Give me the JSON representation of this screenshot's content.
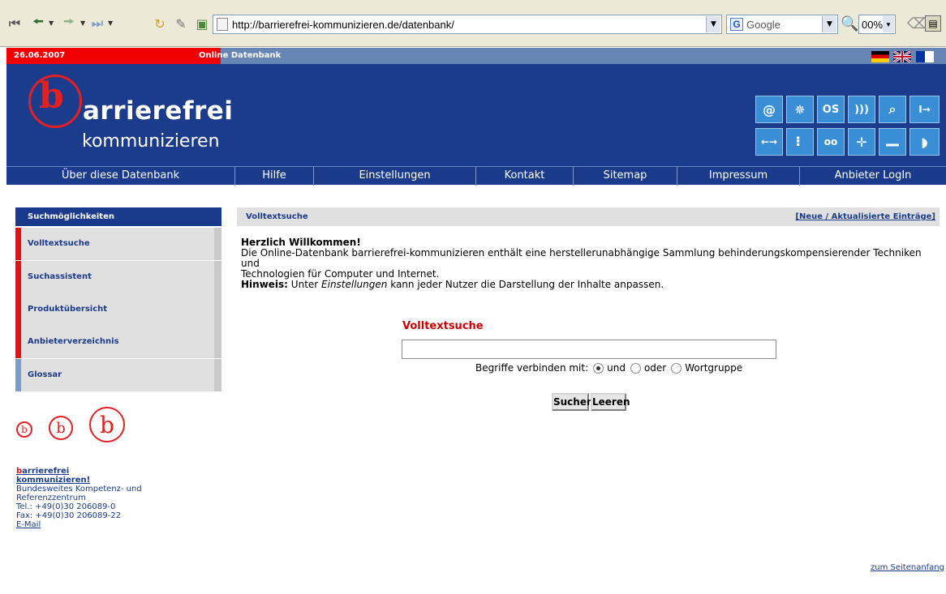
{
  "browser": {
    "url": "http://barrierefrei-kommunizieren.de/datenbank/",
    "search_engine_label": "Google",
    "zoom": "00%"
  },
  "header": {
    "date": "26.06.2007",
    "section": "Online Datenbank",
    "logo_line1": "arrierefrei",
    "logo_line2": "kommunizieren",
    "logo_letter": "b",
    "flags": [
      "de",
      "uk",
      "fr"
    ],
    "icons_top": [
      "@",
      "✵",
      "OS",
      ")))",
      "⌕",
      "I→"
    ],
    "icons_bottom": [
      "←→",
      "⠇",
      "oo",
      "✛",
      "▂▂",
      "◗"
    ]
  },
  "nav": {
    "items": [
      "Über diese Datenbank",
      "Hilfe",
      "Einstellungen",
      "Kontakt",
      "Sitemap",
      "Impressum",
      "Anbieter LogIn"
    ]
  },
  "sidebar": {
    "title": "Suchmöglichkeiten",
    "items": [
      "Volltextsuche",
      "Suchassistent",
      "Produktübersicht",
      "Anbieterverzeichnis",
      "Glossar"
    ],
    "org_name_red": "b",
    "org_name_rest": "arrierefrei",
    "org_name_line2": "kommunizieren!",
    "contact_line1": "Bundesweites Kompetenz- und",
    "contact_line2": "Referenzzentrum",
    "phone": "Tel.: +49(0)30 206089-0",
    "fax": "Fax: +49(0)30 206089-22",
    "email": "E-Mail"
  },
  "main": {
    "section_title": "Volltextsuche",
    "new_entries_link": "[Neue / Aktualisierte Einträge]",
    "welcome_title": "Herzlich Willkommen!",
    "welcome_text1": "Die Online-Datenbank barrierefrei-kommunizieren enthält eine herstellerunabhängige Sammlung behinderungskompensierender Techniken und",
    "welcome_text2": "Technologien für Computer und Internet.",
    "hint_label": "Hinweis:",
    "hint_pre": " Unter ",
    "hint_em": "Einstellungen",
    "hint_post": " kann jeder Nutzer die Darstellung der Inhalte anpassen.",
    "form_title": "Volltextsuche",
    "search_value": "",
    "connect_label": "Begriffe verbinden mit:",
    "radio_options": [
      "und",
      "oder",
      "Wortgruppe"
    ],
    "radio_selected": "und",
    "search_button": "Suchen",
    "clear_button": "Leeren",
    "top_link": "zum Seitenanfang"
  },
  "colors": {
    "brand_blue": "#1a3b8c",
    "brand_red": "#e81010",
    "icon_blue": "#3a8ed6"
  }
}
